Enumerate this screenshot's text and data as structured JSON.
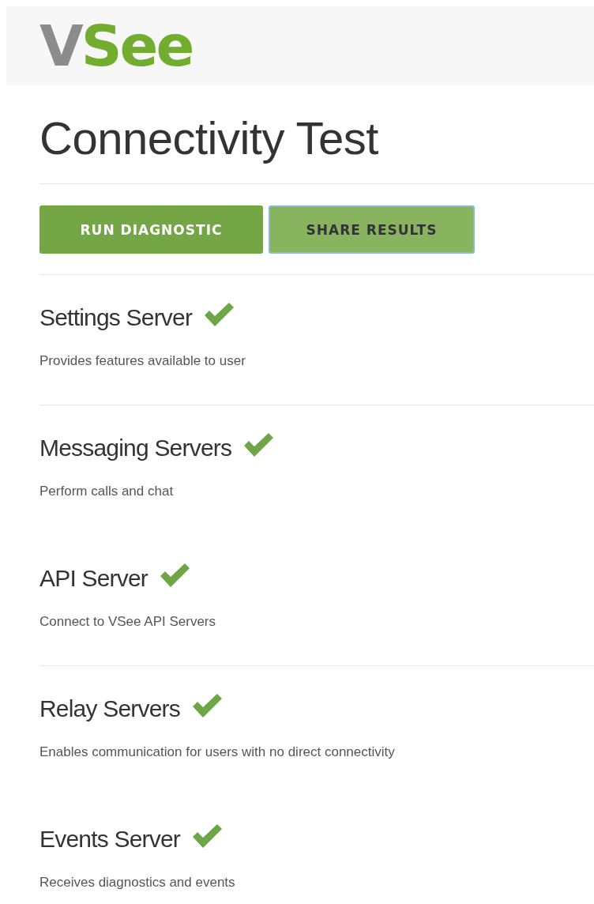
{
  "logo": {
    "parts": [
      {
        "text": "V",
        "kind": "gray"
      },
      {
        "text": "See",
        "kind": "green"
      }
    ]
  },
  "title": "Connectivity Test",
  "buttons": [
    {
      "label": "RUN DIAGNOSTIC",
      "kind": "primary"
    },
    {
      "label": "SHARE RESULTS",
      "kind": "focused"
    }
  ],
  "servers": [
    {
      "name": "Settings Server",
      "description": "Provides features available to user",
      "passed": true,
      "divider_above": true
    },
    {
      "name": "Messaging Servers",
      "description": "Perform calls and chat",
      "passed": true,
      "divider_above": true
    },
    {
      "name": "API Server",
      "description": "Connect to VSee API Servers",
      "passed": true,
      "divider_above": false
    },
    {
      "name": "Relay Servers",
      "description": "Enables communication for users with no direct connectivity",
      "passed": true,
      "divider_above": true
    },
    {
      "name": "Events Server",
      "description": "Receives diagnostics and events",
      "passed": true,
      "divider_above": false
    }
  ]
}
